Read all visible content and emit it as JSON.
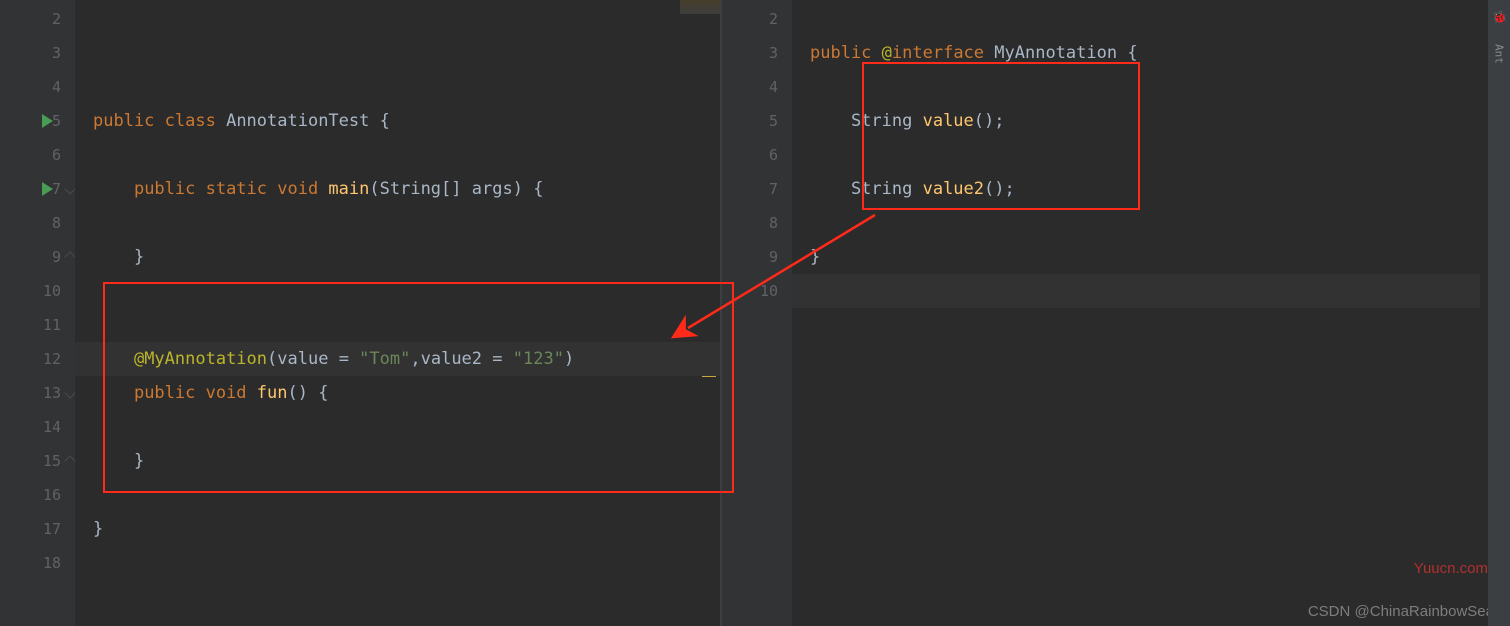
{
  "left": {
    "lines": {
      "2": "",
      "3": "",
      "4": "",
      "5": [
        {
          "t": "public ",
          "c": "kw"
        },
        {
          "t": "class ",
          "c": "kw"
        },
        {
          "t": "AnnotationTest ",
          "c": "cls"
        },
        {
          "t": "{",
          "c": "punct"
        }
      ],
      "6": "",
      "7": [
        {
          "t": "    ",
          "c": ""
        },
        {
          "t": "public static void ",
          "c": "kw"
        },
        {
          "t": "main",
          "c": "method-decl"
        },
        {
          "t": "(",
          "c": "punct"
        },
        {
          "t": "String",
          "c": "cls"
        },
        {
          "t": "[] ",
          "c": "punct"
        },
        {
          "t": "args",
          "c": "param"
        },
        {
          "t": ") {",
          "c": "punct"
        }
      ],
      "8": "",
      "9": [
        {
          "t": "    }",
          "c": "punct"
        }
      ],
      "10": "",
      "11": "",
      "12": [
        {
          "t": "    ",
          "c": ""
        },
        {
          "t": "@MyAnnotation",
          "c": "ann"
        },
        {
          "t": "(",
          "c": "punct"
        },
        {
          "t": "value ",
          "c": "anntext"
        },
        {
          "t": "= ",
          "c": "punct"
        },
        {
          "t": "\"Tom\"",
          "c": "str"
        },
        {
          "t": ",",
          "c": "punct"
        },
        {
          "t": "value2 ",
          "c": "anntext"
        },
        {
          "t": "= ",
          "c": "punct"
        },
        {
          "t": "\"123\"",
          "c": "str"
        },
        {
          "t": ")",
          "c": "punct"
        }
      ],
      "13": [
        {
          "t": "    ",
          "c": ""
        },
        {
          "t": "public void ",
          "c": "kw"
        },
        {
          "t": "fun",
          "c": "method-decl"
        },
        {
          "t": "() {",
          "c": "punct"
        }
      ],
      "14": "",
      "15": [
        {
          "t": "    }",
          "c": "punct"
        }
      ],
      "16": "",
      "17": [
        {
          "t": "}",
          "c": "punct"
        }
      ],
      "18": ""
    },
    "runLines": [
      5,
      7
    ],
    "foldOpen": [
      7,
      13
    ],
    "foldClose": [
      9,
      15
    ],
    "currentLine": 12
  },
  "right": {
    "lines": {
      "2": "",
      "3": [
        {
          "t": "public ",
          "c": "kw"
        },
        {
          "t": "@",
          "c": "ann"
        },
        {
          "t": "interface ",
          "c": "kw"
        },
        {
          "t": "MyAnnotation ",
          "c": "cls"
        },
        {
          "t": "{",
          "c": "punct"
        }
      ],
      "4": "",
      "5": [
        {
          "t": "    String ",
          "c": "cls"
        },
        {
          "t": "value",
          "c": "method-decl"
        },
        {
          "t": "();",
          "c": "punct"
        }
      ],
      "6": "",
      "7": [
        {
          "t": "    String ",
          "c": "cls"
        },
        {
          "t": "value2",
          "c": "method-decl"
        },
        {
          "t": "();",
          "c": "punct"
        }
      ],
      "8": "",
      "9": [
        {
          "t": "}",
          "c": "punct"
        }
      ],
      "10": ""
    },
    "currentLine": 10
  },
  "watermarks": {
    "right": "Yuucn.com",
    "bottom": "CSDN @ChinaRainbowSea"
  },
  "rail": {
    "antLabel": "Ant"
  }
}
